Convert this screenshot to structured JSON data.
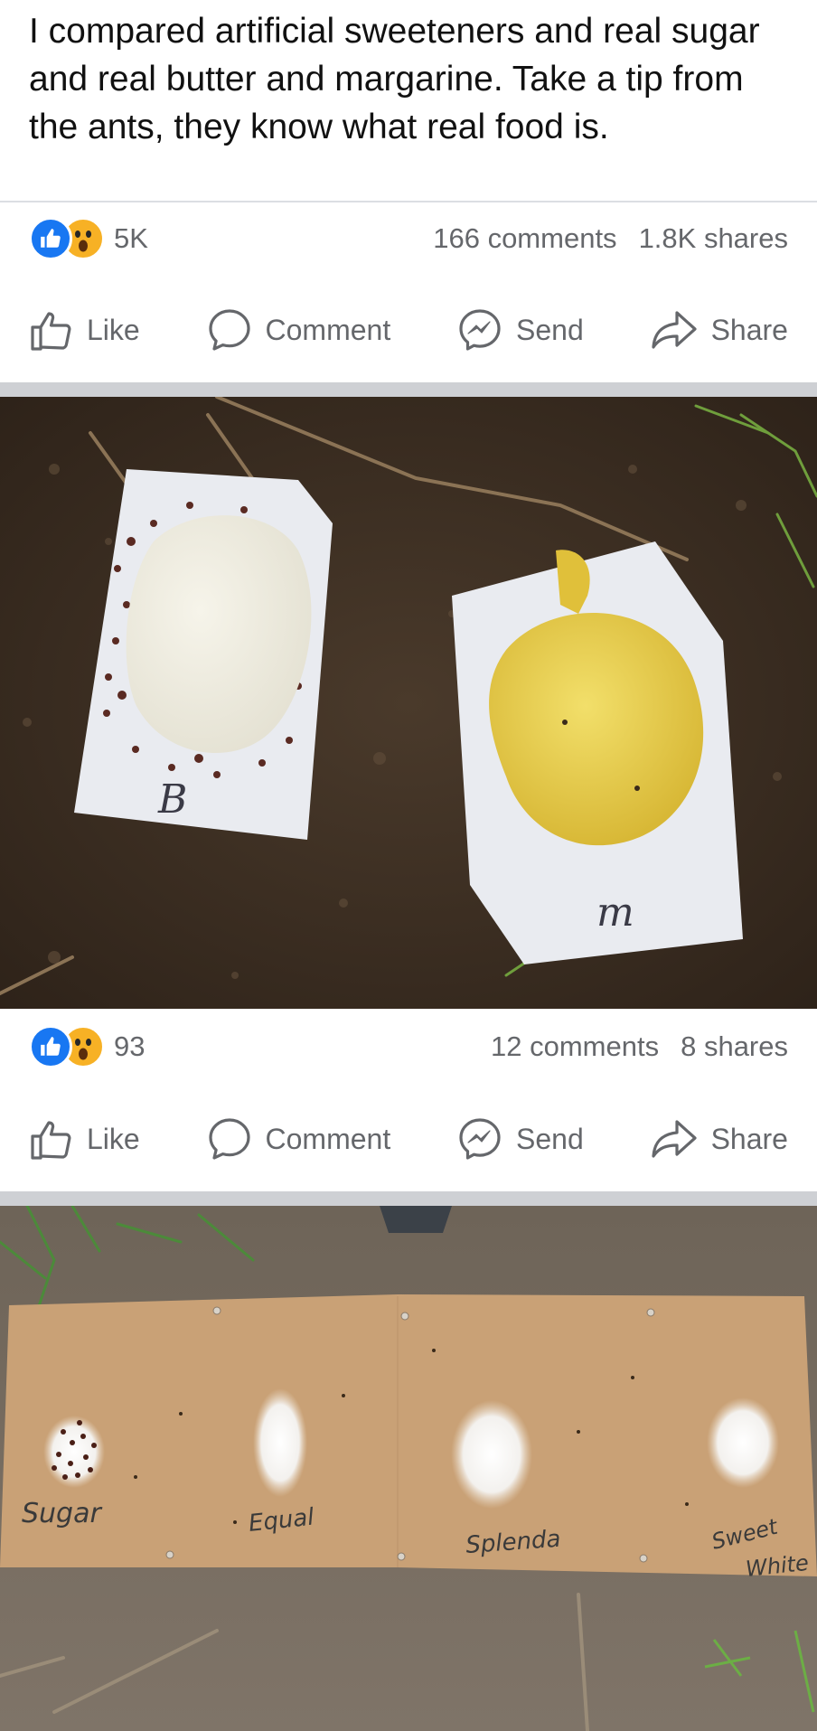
{
  "post": {
    "text": "I compared artificial sweeteners and real sugar and real butter and margarine.  Take a tip from the ants, they know what real food is.",
    "reaction_count": "5K",
    "comments": "166 comments",
    "shares": "1.8K shares"
  },
  "photo1": {
    "reaction_count": "93",
    "comments": "12 comments",
    "shares": "8 shares",
    "label_left": "B",
    "label_right": "m"
  },
  "photo2": {
    "labels": [
      "Sugar",
      "Equal",
      "Splenda",
      "Sweet",
      "White"
    ]
  },
  "actions": {
    "like": "Like",
    "comment": "Comment",
    "send": "Send",
    "share": "Share"
  },
  "icons": [
    "like-reaction-icon",
    "wow-reaction-icon",
    "thumbs-up-icon",
    "comment-bubble-icon",
    "messenger-icon",
    "share-arrow-icon"
  ],
  "colors": {
    "facebook_blue": "#1877f2",
    "wow_yellow": "#f7b125",
    "secondary_text": "#65676b",
    "separator": "#ced0d4"
  }
}
